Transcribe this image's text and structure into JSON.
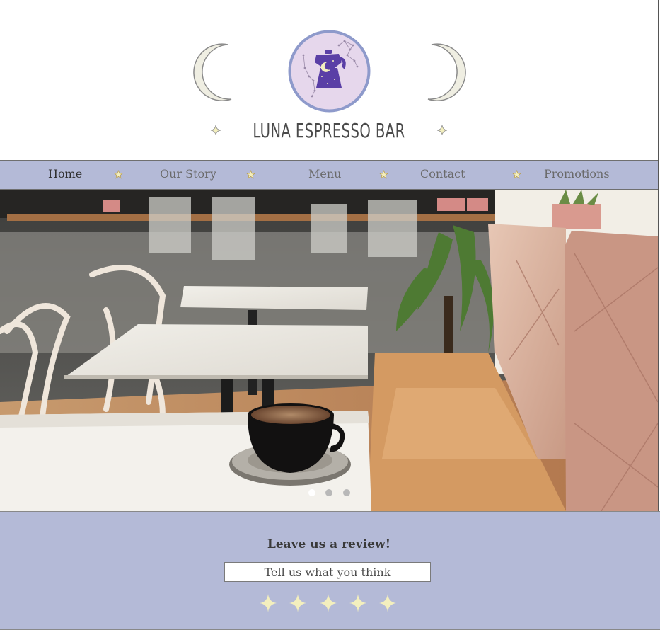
{
  "brand": {
    "name": "LUNA ESPRESSO BAR"
  },
  "nav": {
    "items": [
      {
        "label": "Home",
        "active": true
      },
      {
        "label": "Our Story",
        "active": false
      },
      {
        "label": "Menu",
        "active": false
      },
      {
        "label": "Contact",
        "active": false
      },
      {
        "label": "Promotions",
        "active": false
      }
    ]
  },
  "hero": {
    "slide_count": 3,
    "active_slide": 1
  },
  "review": {
    "title": "Leave us a review!",
    "input_placeholder": "Tell us what you think",
    "star_count": 5,
    "rating": 0
  },
  "colors": {
    "nav_bg": "#b4bad7",
    "review_bg": "#b4bad7",
    "star": "#f3efbe",
    "moon": "#efeee2",
    "logo_ring": "#8e9acb",
    "logo_fill": "#e6d7ec",
    "moka_pot": "#5a3fa6"
  },
  "icons": [
    "crescent-moon-icon",
    "moka-pot-logo",
    "sparkle-icon",
    "nav-star-icon",
    "rating-star-icon"
  ]
}
